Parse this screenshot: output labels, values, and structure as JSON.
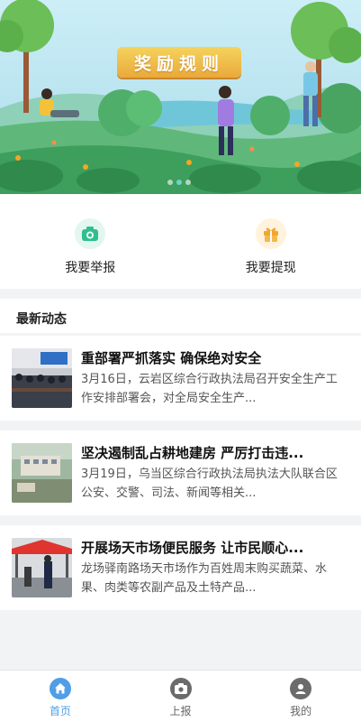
{
  "banner": {
    "title": "奖励规则",
    "slide_count": 3,
    "active_slide": 1
  },
  "actions": [
    {
      "label": "我要举报",
      "icon": "camera-icon"
    },
    {
      "label": "我要提现",
      "icon": "gift-icon"
    }
  ],
  "news": {
    "header": "最新动态",
    "items": [
      {
        "title": "重部署严抓落实 确保绝对安全",
        "desc": "3月16日，云岩区综合行政执法局召开安全生产工作安排部署会，对全局安全生产...",
        "thumb": "meeting-photo"
      },
      {
        "title": "坚决遏制乱占耕地建房 严厉打击违...",
        "desc": "3月19日，乌当区综合行政执法局执法大队联合区公安、交警、司法、新闻等相关...",
        "thumb": "construction-site-photo"
      },
      {
        "title": "开展场天市场便民服务 让市民顺心...",
        "desc": "龙场驿南路场天市场作为百姓周末购买蔬菜、水果、肉类等农副产品及土特产品...",
        "thumb": "market-photo"
      }
    ]
  },
  "tabbar": [
    {
      "label": "首页",
      "icon": "home-icon",
      "active": true
    },
    {
      "label": "上报",
      "icon": "report-icon",
      "active": false
    },
    {
      "label": "我的",
      "icon": "user-icon",
      "active": false
    }
  ],
  "colors": {
    "accent": "#4f9ee6",
    "banner_button": "#e9a93a",
    "report_icon": "#2fbf8f",
    "withdraw_icon": "#f2a62f"
  }
}
